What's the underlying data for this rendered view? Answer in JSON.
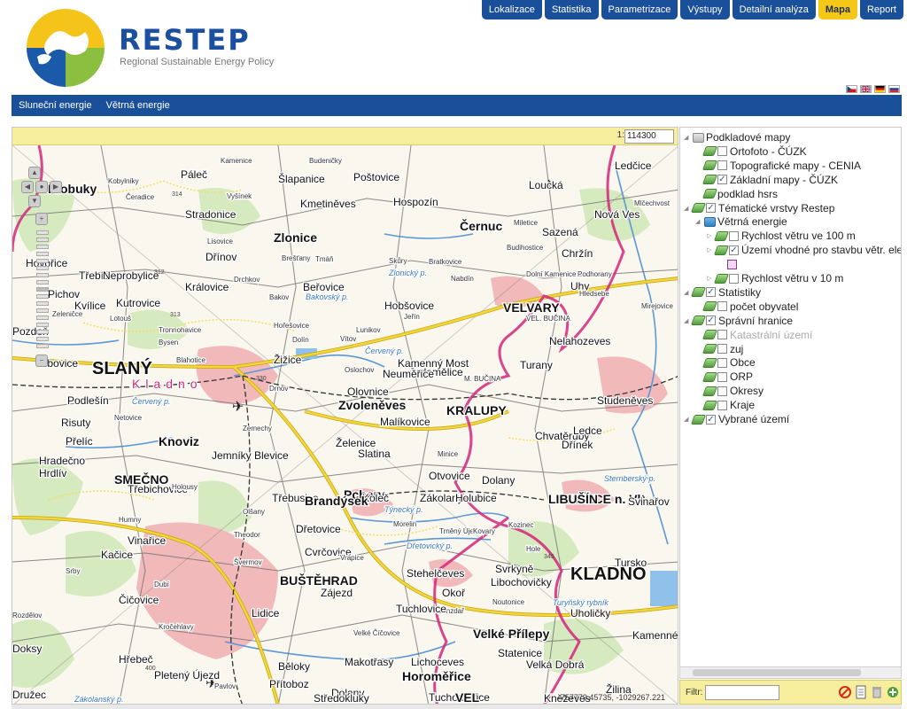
{
  "brand": {
    "title": "RESTEP",
    "subtitle": "Regional Sustainable Energy Policy"
  },
  "top_nav": [
    {
      "label": "Lokalizace",
      "active": false
    },
    {
      "label": "Statistika",
      "active": false
    },
    {
      "label": "Parametrizace",
      "active": false
    },
    {
      "label": "Výstupy",
      "active": false
    },
    {
      "label": "Detailní analýza",
      "active": false
    },
    {
      "label": "Mapa",
      "active": true
    },
    {
      "label": "Report",
      "active": false
    }
  ],
  "languages": [
    {
      "code": "cz",
      "icon": "czech-flag-icon"
    },
    {
      "code": "en",
      "icon": "uk-flag-icon"
    },
    {
      "code": "de",
      "icon": "german-flag-icon"
    },
    {
      "code": "ru",
      "icon": "russian-flag-icon"
    }
  ],
  "sub_nav": [
    {
      "label": "Sluneční energie"
    },
    {
      "label": "Větrná energie"
    }
  ],
  "map": {
    "scale_prefix": "1:",
    "scale_value": "114300",
    "coords": "-757779.45735, -1029267.221",
    "place_labels": [
      {
        "name": "Klobuky",
        "style": "town"
      },
      {
        "name": "Páleč",
        "style": "village"
      },
      {
        "name": "Šlapanice",
        "style": "village"
      },
      {
        "name": "Poštovice",
        "style": "village"
      },
      {
        "name": "Ledčice",
        "style": "village"
      },
      {
        "name": "Loucká",
        "style": "village"
      },
      {
        "name": "Budeničky",
        "style": "small"
      },
      {
        "name": "Kamenice",
        "style": "small"
      },
      {
        "name": "Čeradice",
        "style": "small"
      },
      {
        "name": "Kobylníky",
        "style": "small"
      },
      {
        "name": "Vyšínek",
        "style": "small"
      },
      {
        "name": "Stradonice",
        "style": "village"
      },
      {
        "name": "Kmetiněves",
        "style": "village"
      },
      {
        "name": "Hospozín",
        "style": "village"
      },
      {
        "name": "Černuc",
        "style": "town"
      },
      {
        "name": "Nová Ves",
        "style": "village"
      },
      {
        "name": "Mlčechvost",
        "style": "small"
      },
      {
        "name": "Zlonice",
        "style": "town"
      },
      {
        "name": "Sazená",
        "style": "village"
      },
      {
        "name": "Miletice",
        "style": "small"
      },
      {
        "name": "Lisovice",
        "style": "small"
      },
      {
        "name": "Hovořice",
        "style": "village"
      },
      {
        "name": "Dřínov",
        "style": "village"
      },
      {
        "name": "Chržín",
        "style": "village"
      },
      {
        "name": "Budihostice",
        "style": "small"
      },
      {
        "name": "Brešťany",
        "style": "small"
      },
      {
        "name": "Tmáň",
        "style": "small"
      },
      {
        "name": "Zlonický p.",
        "style": "water"
      },
      {
        "name": "Třebíz",
        "style": "village"
      },
      {
        "name": "Neprobylice",
        "style": "village"
      },
      {
        "name": "Skůry",
        "style": "small"
      },
      {
        "name": "Bratkovice",
        "style": "small"
      },
      {
        "name": "Nabdín",
        "style": "small"
      },
      {
        "name": "Dolní Kamenice",
        "style": "small"
      },
      {
        "name": "Podhorany",
        "style": "small"
      },
      {
        "name": "Uhy",
        "style": "village"
      },
      {
        "name": "Pichov",
        "style": "village"
      },
      {
        "name": "Královice",
        "style": "village"
      },
      {
        "name": "Drchkov",
        "style": "small"
      },
      {
        "name": "Beřovice",
        "style": "village"
      },
      {
        "name": "Hledsebe",
        "style": "small"
      },
      {
        "name": "Kvílice",
        "style": "village"
      },
      {
        "name": "Kutrovice",
        "style": "village"
      },
      {
        "name": "Bakov",
        "style": "small"
      },
      {
        "name": "Bakovský p.",
        "style": "water"
      },
      {
        "name": "Hobšovice",
        "style": "village"
      },
      {
        "name": "VELVARY",
        "style": "town"
      },
      {
        "name": "Lotouš",
        "style": "small"
      },
      {
        "name": "Zeleničce",
        "style": "small"
      },
      {
        "name": "Jeřín",
        "style": "small"
      },
      {
        "name": "VEL. BUČINA",
        "style": "small"
      },
      {
        "name": "Mirejovice",
        "style": "small"
      },
      {
        "name": "Pozdeň",
        "style": "village"
      },
      {
        "name": "Tronnohavice",
        "style": "small"
      },
      {
        "name": "Dolín",
        "style": "small"
      },
      {
        "name": "Vítov",
        "style": "small"
      },
      {
        "name": "Lunikov",
        "style": "small"
      },
      {
        "name": "Nelahozeves",
        "style": "village"
      },
      {
        "name": "Hořešovice",
        "style": "small"
      },
      {
        "name": "Bysen",
        "style": "small"
      },
      {
        "name": "Červený p.",
        "style": "water"
      },
      {
        "name": "Kamenný Most",
        "style": "village"
      },
      {
        "name": "Jedomělice",
        "style": "village"
      },
      {
        "name": "Libovice",
        "style": "village"
      },
      {
        "name": "SLANÝ",
        "style": "city"
      },
      {
        "name": "Blahotice",
        "style": "small"
      },
      {
        "name": "Žižice",
        "style": "village"
      },
      {
        "name": "Oslochov",
        "style": "small"
      },
      {
        "name": "Neuměřice",
        "style": "village"
      },
      {
        "name": "M. BUČINA",
        "style": "small"
      },
      {
        "name": "Turany",
        "style": "village"
      },
      {
        "name": "Kladno",
        "style": "district"
      },
      {
        "name": "Drnov",
        "style": "small"
      },
      {
        "name": "Olovnice",
        "style": "village"
      },
      {
        "name": "KRALUPY",
        "style": "town"
      },
      {
        "name": "Studeněves",
        "style": "village"
      },
      {
        "name": "Červený p.",
        "style": "water"
      },
      {
        "name": "Podlešín",
        "style": "village"
      },
      {
        "name": "Zvoleněves",
        "style": "town"
      },
      {
        "name": "Malíkovice",
        "style": "village"
      },
      {
        "name": "Risuty",
        "style": "village"
      },
      {
        "name": "Netovice",
        "style": "small"
      },
      {
        "name": "Zemechy",
        "style": "small"
      },
      {
        "name": "Chvatěruby",
        "style": "village"
      },
      {
        "name": "Ledce",
        "style": "village"
      },
      {
        "name": "Přelíc",
        "style": "village"
      },
      {
        "name": "Knoviz",
        "style": "town"
      },
      {
        "name": "Želenice",
        "style": "village"
      },
      {
        "name": "Slatina",
        "style": "village"
      },
      {
        "name": "Minice",
        "style": "small"
      },
      {
        "name": "Dřínek",
        "style": "village"
      },
      {
        "name": "Hradečno",
        "style": "village"
      },
      {
        "name": "Hrdlív",
        "style": "village"
      },
      {
        "name": "Jemníky",
        "style": "village"
      },
      {
        "name": "Blevice",
        "style": "village"
      },
      {
        "name": "Otvovice",
        "style": "village"
      },
      {
        "name": "Dolany",
        "style": "village"
      },
      {
        "name": "Sternberský p.",
        "style": "water"
      },
      {
        "name": "SMEČNO",
        "style": "town"
      },
      {
        "name": "Třebichovice",
        "style": "village"
      },
      {
        "name": "Holousy",
        "style": "small"
      },
      {
        "name": "Pchery",
        "style": "town"
      },
      {
        "name": "Třebusice",
        "style": "village"
      },
      {
        "name": "Koleč",
        "style": "village"
      },
      {
        "name": "Zákolany",
        "style": "village"
      },
      {
        "name": "Holubice",
        "style": "village"
      },
      {
        "name": "LIBČICE n. Vlt.",
        "style": "town"
      },
      {
        "name": "Svinařov",
        "style": "village"
      },
      {
        "name": "Humny",
        "style": "small"
      },
      {
        "name": "Olšany",
        "style": "small"
      },
      {
        "name": "Brandýsek",
        "style": "town"
      },
      {
        "name": "Týnecký p.",
        "style": "water"
      },
      {
        "name": "Trněný Újezd",
        "style": "small"
      },
      {
        "name": "LIBUŠÍN",
        "style": "town"
      },
      {
        "name": "Vinařice",
        "style": "village"
      },
      {
        "name": "Theodor",
        "style": "small"
      },
      {
        "name": "Dřetovice",
        "style": "village"
      },
      {
        "name": "Morelin",
        "style": "small"
      },
      {
        "name": "Kovary",
        "style": "small"
      },
      {
        "name": "Kozinec",
        "style": "small"
      },
      {
        "name": "Kačice",
        "style": "village"
      },
      {
        "name": "Cvrčovice",
        "style": "village"
      },
      {
        "name": "Dřetovický p.",
        "style": "water"
      },
      {
        "name": "Hole",
        "style": "small"
      },
      {
        "name": "Tursko",
        "style": "village"
      },
      {
        "name": "Švermov",
        "style": "small"
      },
      {
        "name": "Vrapice",
        "style": "small"
      },
      {
        "name": "Stehelčeves",
        "style": "village"
      },
      {
        "name": "Libochovičky",
        "style": "village"
      },
      {
        "name": "Svrkyně",
        "style": "village"
      },
      {
        "name": "KLADNO",
        "style": "city"
      },
      {
        "name": "Dubí",
        "style": "small"
      },
      {
        "name": "BUŠTĚHRAD",
        "style": "town"
      },
      {
        "name": "Zájezd",
        "style": "village"
      },
      {
        "name": "Okoř",
        "style": "village"
      },
      {
        "name": "Noutonice",
        "style": "small"
      },
      {
        "name": "Turyňský rybník",
        "style": "water"
      },
      {
        "name": "Srby",
        "style": "small"
      },
      {
        "name": "Čičovice",
        "style": "village"
      },
      {
        "name": "Bůnzdař",
        "style": "small"
      },
      {
        "name": "Tuchlovice",
        "style": "village"
      },
      {
        "name": "Rozdělov",
        "style": "small"
      },
      {
        "name": "Kročehlavy",
        "style": "small"
      },
      {
        "name": "Lidice",
        "style": "village"
      },
      {
        "name": "Velké Číčovice",
        "style": "small"
      },
      {
        "name": "Velké Přílepy",
        "style": "town"
      },
      {
        "name": "Uholičky",
        "style": "village"
      },
      {
        "name": "Kamenné Žehrovice",
        "style": "village"
      },
      {
        "name": "Doksy",
        "style": "village"
      },
      {
        "name": "Hřebeč",
        "style": "village"
      },
      {
        "name": "Makotřasy",
        "style": "village"
      },
      {
        "name": "Lichoceves",
        "style": "village"
      },
      {
        "name": "Statenice",
        "style": "village"
      },
      {
        "name": "Velká Dobrá",
        "style": "village"
      },
      {
        "name": "Pletený Újezd",
        "style": "village"
      },
      {
        "name": "Pavlov",
        "style": "small"
      },
      {
        "name": "Přítoboz",
        "style": "village"
      },
      {
        "name": "Běloky",
        "style": "village"
      },
      {
        "name": "Horoměřice",
        "style": "town"
      },
      {
        "name": "Žilina",
        "style": "village"
      },
      {
        "name": "Družec",
        "style": "village"
      },
      {
        "name": "Zákolanský p.",
        "style": "water"
      },
      {
        "name": "Dolany",
        "style": "village"
      },
      {
        "name": "Středokluky",
        "style": "village"
      },
      {
        "name": "Tuchoměřice",
        "style": "village"
      },
      {
        "name": "Kněževes",
        "style": "village"
      },
      {
        "name": "VEL",
        "style": "town"
      }
    ],
    "spot_heights": [
      "314",
      "312",
      "313",
      "330",
      "345",
      "400"
    ]
  },
  "layer_tree": [
    {
      "label": "Podkladové mapy",
      "level": 0,
      "icon": "folder",
      "checkbox": false,
      "checked": false,
      "disabled": false
    },
    {
      "label": "Ortofoto - ČÚZK",
      "level": 1,
      "icon": "layer",
      "checkbox": true,
      "checked": false,
      "disabled": false
    },
    {
      "label": "Topografické mapy - CENIA",
      "level": 1,
      "icon": "layer",
      "checkbox": true,
      "checked": false,
      "disabled": false
    },
    {
      "label": "Základní mapy - ČÚZK",
      "level": 1,
      "icon": "layer",
      "checkbox": true,
      "checked": true,
      "disabled": false
    },
    {
      "label": "podklad hsrs",
      "level": 1,
      "icon": "layer",
      "checkbox": false,
      "checked": false,
      "disabled": false
    },
    {
      "label": "Tématické vrstvy Restep",
      "level": 0,
      "icon": "layer",
      "checkbox": true,
      "checked": true,
      "disabled": false
    },
    {
      "label": "Větrná energie",
      "level": 1,
      "icon": "group",
      "checkbox": false,
      "checked": false,
      "disabled": false
    },
    {
      "label": "Rychlost větru ve 100 m",
      "level": 2,
      "icon": "layer",
      "checkbox": true,
      "checked": false,
      "disabled": false
    },
    {
      "label": "Území vhodné pro stavbu větr. elektráren",
      "level": 2,
      "icon": "layer",
      "checkbox": true,
      "checked": true,
      "disabled": false
    },
    {
      "label": "",
      "level": 3,
      "icon": "legend",
      "checkbox": false,
      "checked": false,
      "disabled": false
    },
    {
      "label": "Rychlost větru v 10 m",
      "level": 2,
      "icon": "layer",
      "checkbox": true,
      "checked": false,
      "disabled": false
    },
    {
      "label": "Statistiky",
      "level": 0,
      "icon": "layer",
      "checkbox": true,
      "checked": true,
      "disabled": false
    },
    {
      "label": "počet obyvatel",
      "level": 1,
      "icon": "layer",
      "checkbox": true,
      "checked": false,
      "disabled": false
    },
    {
      "label": "Správní hranice",
      "level": 0,
      "icon": "layer",
      "checkbox": true,
      "checked": true,
      "disabled": false
    },
    {
      "label": "Katastrální území",
      "level": 1,
      "icon": "layer",
      "checkbox": true,
      "checked": false,
      "disabled": true
    },
    {
      "label": "zuj",
      "level": 1,
      "icon": "layer",
      "checkbox": true,
      "checked": false,
      "disabled": false
    },
    {
      "label": "Obce",
      "level": 1,
      "icon": "layer",
      "checkbox": true,
      "checked": false,
      "disabled": false
    },
    {
      "label": "ORP",
      "level": 1,
      "icon": "layer",
      "checkbox": true,
      "checked": false,
      "disabled": false
    },
    {
      "label": "Okresy",
      "level": 1,
      "icon": "layer",
      "checkbox": true,
      "checked": false,
      "disabled": false
    },
    {
      "label": "Kraje",
      "level": 1,
      "icon": "layer",
      "checkbox": true,
      "checked": false,
      "disabled": false
    },
    {
      "label": "Vybrané území",
      "level": 0,
      "icon": "layer",
      "checkbox": true,
      "checked": true,
      "disabled": false
    }
  ],
  "filter": {
    "label": "Filtr:",
    "value": "",
    "buttons": [
      "clear-filter-icon",
      "document-icon",
      "trash-icon",
      "add-layer-icon"
    ]
  },
  "colors": {
    "nav_blue": "#1a4f99",
    "active_yellow": "#f5c818",
    "toolbar_yellow": "#f7ee9d",
    "boundary_magenta": "#d3267a",
    "road_yellow": "#f2d63c",
    "water_blue": "#5b98d5",
    "urban_pink": "#f2b9bb",
    "forest_green": "#cfe6b3"
  }
}
